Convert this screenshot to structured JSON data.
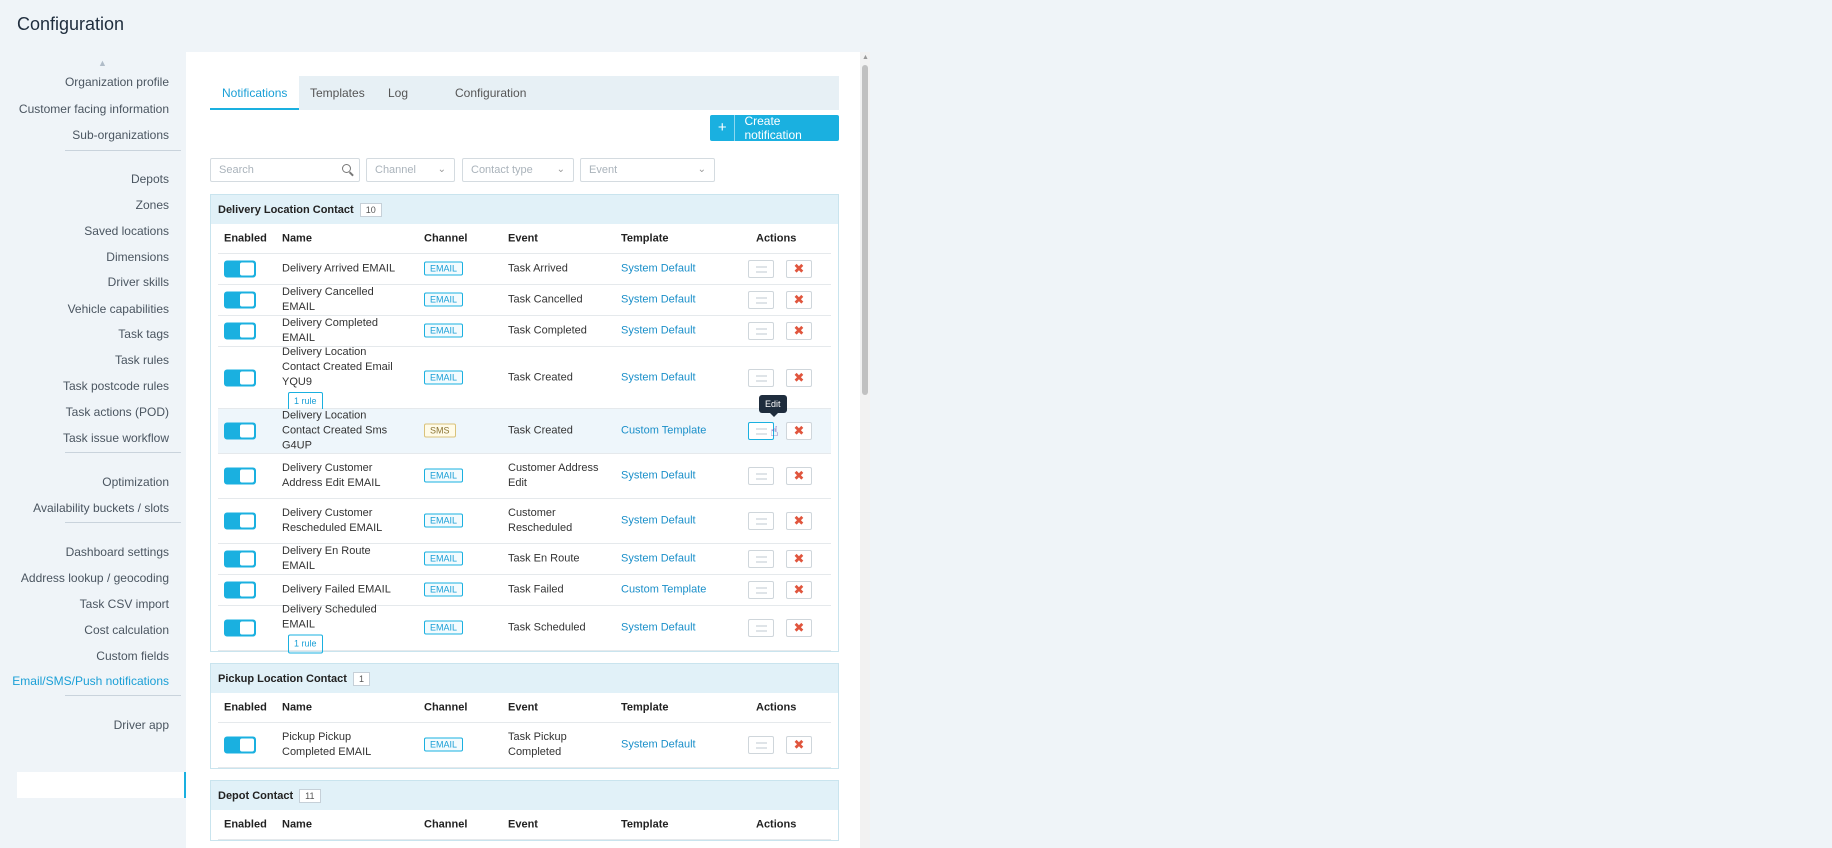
{
  "page_title": "Configuration",
  "sidebar": {
    "groups": [
      [
        "Organization profile",
        "Customer facing information",
        "Sub-organizations"
      ],
      [
        "Depots",
        "Zones",
        "Saved locations",
        "Dimensions",
        "Driver skills",
        "Vehicle capabilities",
        "Task tags",
        "Task rules",
        "Task postcode rules",
        "Task actions (POD)",
        "Task issue workflow"
      ],
      [
        "Optimization",
        "Availability buckets / slots"
      ],
      [
        "Dashboard settings",
        "Address lookup / geocoding",
        "Task CSV import",
        "Cost calculation",
        "Custom fields",
        "Email/SMS/Push notifications"
      ],
      [
        "Driver app"
      ]
    ],
    "active": "Email/SMS/Push notifications"
  },
  "tabs": [
    "Notifications",
    "Templates",
    "Log",
    "Configuration"
  ],
  "active_tab": "Notifications",
  "create_button": "Create notification",
  "filters": {
    "search_placeholder": "Search",
    "channel": "Channel",
    "contact_type": "Contact type",
    "event": "Event"
  },
  "columns": [
    "Enabled",
    "Name",
    "Channel",
    "Event",
    "Template",
    "Actions"
  ],
  "tooltip": "Edit",
  "sections": [
    {
      "title": "Delivery Location Contact",
      "count": "10",
      "rows": [
        {
          "name": "Delivery Arrived EMAIL",
          "channel": "EMAIL",
          "event": "Task Arrived",
          "template": "System Default",
          "rule": ""
        },
        {
          "name": "Delivery Cancelled EMAIL",
          "channel": "EMAIL",
          "event": "Task Cancelled",
          "template": "System Default",
          "rule": ""
        },
        {
          "name": "Delivery Completed EMAIL",
          "channel": "EMAIL",
          "event": "Task Completed",
          "template": "System Default",
          "rule": ""
        },
        {
          "name": "Delivery Location Contact Created Email YQU9",
          "channel": "EMAIL",
          "event": "Task Created",
          "template": "System Default",
          "rule": "1 rule"
        },
        {
          "name": "Delivery Location Contact Created Sms G4UP",
          "channel": "SMS",
          "event": "Task Created",
          "template": "Custom Template",
          "rule": ""
        },
        {
          "name": "Delivery Customer Address Edit EMAIL",
          "channel": "EMAIL",
          "event": "Customer Address Edit",
          "template": "System Default",
          "rule": ""
        },
        {
          "name": "Delivery Customer Rescheduled EMAIL",
          "channel": "EMAIL",
          "event": "Customer Rescheduled",
          "template": "System Default",
          "rule": ""
        },
        {
          "name": "Delivery En Route EMAIL",
          "channel": "EMAIL",
          "event": "Task En Route",
          "template": "System Default",
          "rule": ""
        },
        {
          "name": "Delivery Failed EMAIL",
          "channel": "EMAIL",
          "event": "Task Failed",
          "template": "Custom Template",
          "rule": ""
        },
        {
          "name": "Delivery Scheduled EMAIL",
          "channel": "EMAIL",
          "event": "Task Scheduled",
          "template": "System Default",
          "rule": "1 rule"
        }
      ]
    },
    {
      "title": "Pickup Location Contact",
      "count": "1",
      "rows": [
        {
          "name": "Pickup Pickup Completed EMAIL",
          "channel": "EMAIL",
          "event": "Task Pickup Completed",
          "template": "System Default",
          "rule": ""
        }
      ]
    },
    {
      "title": "Depot Contact",
      "count": "11",
      "rows": []
    }
  ]
}
